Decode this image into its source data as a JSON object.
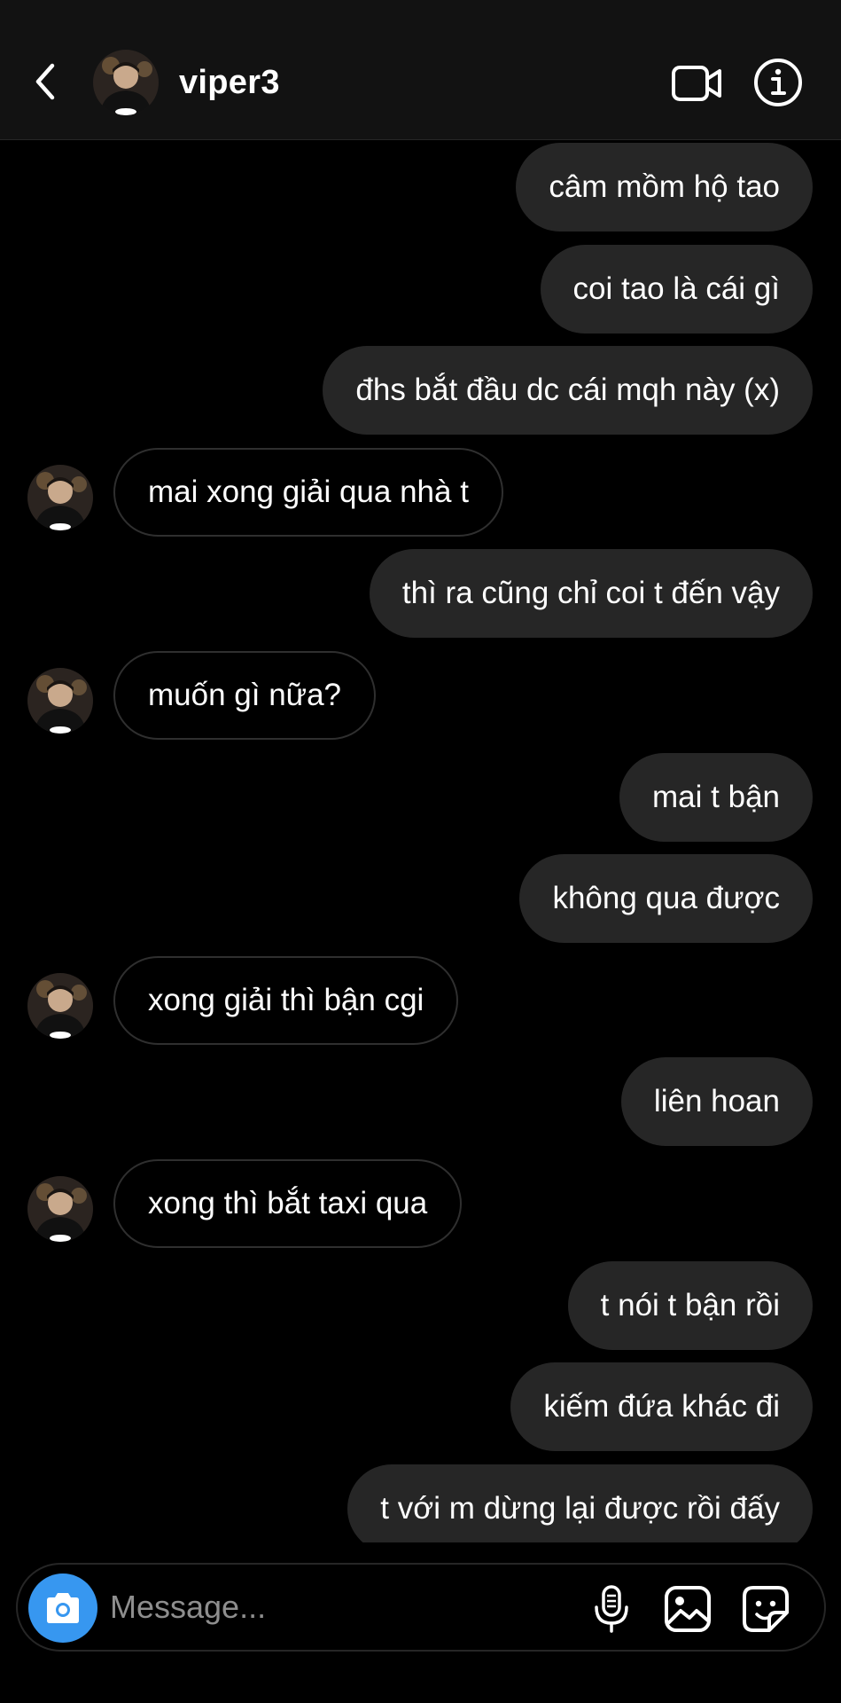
{
  "header": {
    "username": "viper3",
    "icons": [
      "chevron-left-icon",
      "video-camera-icon",
      "info-icon"
    ]
  },
  "messages": [
    {
      "side": "sent",
      "text": "câm mồm hộ tao"
    },
    {
      "side": "sent",
      "text": "coi tao là cái gì"
    },
    {
      "side": "sent",
      "text": "đhs bắt đầu dc cái mqh này (x)"
    },
    {
      "side": "received",
      "text": "mai xong giải qua nhà t"
    },
    {
      "side": "sent",
      "text": "thì ra cũng chỉ coi t đến vậy"
    },
    {
      "side": "received",
      "text": "muốn gì nữa?"
    },
    {
      "side": "sent",
      "text": "mai t bận"
    },
    {
      "side": "sent",
      "text": "không qua được"
    },
    {
      "side": "received",
      "text": "xong giải thì bận cgi"
    },
    {
      "side": "sent",
      "text": "liên hoan"
    },
    {
      "side": "received",
      "text": "xong thì bắt taxi qua"
    },
    {
      "side": "sent",
      "text": "t nói t bận rồi"
    },
    {
      "side": "sent",
      "text": "kiếm đứa khác đi"
    },
    {
      "side": "sent",
      "text": "t với m dừng lại được rồi đấy"
    }
  ],
  "composer": {
    "placeholder": "Message...",
    "icons": [
      "camera-icon",
      "microphone-icon",
      "gallery-icon",
      "sticker-icon"
    ]
  },
  "colors": {
    "background": "#000000",
    "header": "#121212",
    "sent_bubble": "#262626",
    "received_border": "#2f2f2f",
    "camera_accent": "#3797f0",
    "placeholder": "#8e8e8e"
  }
}
